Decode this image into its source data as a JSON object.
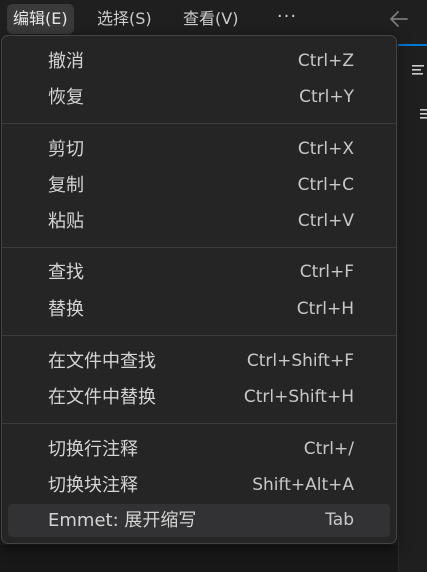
{
  "menubar": {
    "items": [
      {
        "label": "编辑(E)",
        "active": true
      },
      {
        "label": "选择(S)",
        "active": false
      },
      {
        "label": "查看(V)",
        "active": false
      }
    ],
    "more_label": "···"
  },
  "edit_menu": {
    "groups": [
      [
        {
          "label": "撤消",
          "shortcut": "Ctrl+Z"
        },
        {
          "label": "恢复",
          "shortcut": "Ctrl+Y"
        }
      ],
      [
        {
          "label": "剪切",
          "shortcut": "Ctrl+X"
        },
        {
          "label": "复制",
          "shortcut": "Ctrl+C"
        },
        {
          "label": "粘贴",
          "shortcut": "Ctrl+V"
        }
      ],
      [
        {
          "label": "查找",
          "shortcut": "Ctrl+F"
        },
        {
          "label": "替换",
          "shortcut": "Ctrl+H"
        }
      ],
      [
        {
          "label": "在文件中查找",
          "shortcut": "Ctrl+Shift+F"
        },
        {
          "label": "在文件中替换",
          "shortcut": "Ctrl+Shift+H"
        }
      ],
      [
        {
          "label": "切换行注释",
          "shortcut": "Ctrl+/"
        },
        {
          "label": "切换块注释",
          "shortcut": "Shift+Alt+A"
        },
        {
          "label": "Emmet: 展开缩写",
          "shortcut": "Tab",
          "highlighted": true
        }
      ]
    ]
  },
  "icons": {
    "back": "arrow-left-icon",
    "editor_outline": "outline-lines-icon"
  },
  "colors": {
    "accent": "#0078d4",
    "menu_bg": "#252526",
    "text": "#d4d4d4"
  }
}
